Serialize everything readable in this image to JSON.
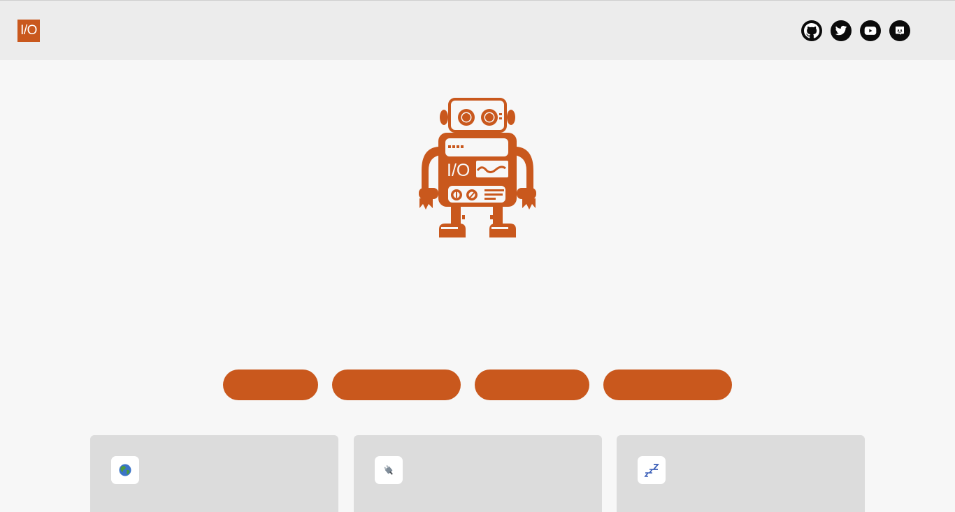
{
  "header": {
    "logo_text": "I/O",
    "social_links": [
      {
        "icon": "github-icon"
      },
      {
        "icon": "twitter-icon"
      },
      {
        "icon": "youtube-icon"
      },
      {
        "icon": "discord-icon"
      }
    ]
  },
  "hero": {
    "image": "robot-mascot",
    "robot_logo_text": "I/O"
  },
  "pill_buttons": [
    {
      "label": ""
    },
    {
      "label": ""
    },
    {
      "label": ""
    },
    {
      "label": ""
    }
  ],
  "feature_cards": [
    {
      "icon": "globe-icon"
    },
    {
      "icon": "plug-icon"
    },
    {
      "icon": "sleep-icon"
    }
  ],
  "colors": {
    "accent": "#c9581d",
    "header_bg": "#ececec",
    "page_bg": "#f7f7f7",
    "card_bg": "#dcdcdc",
    "social_icon_bg": "#0b0b0b"
  }
}
